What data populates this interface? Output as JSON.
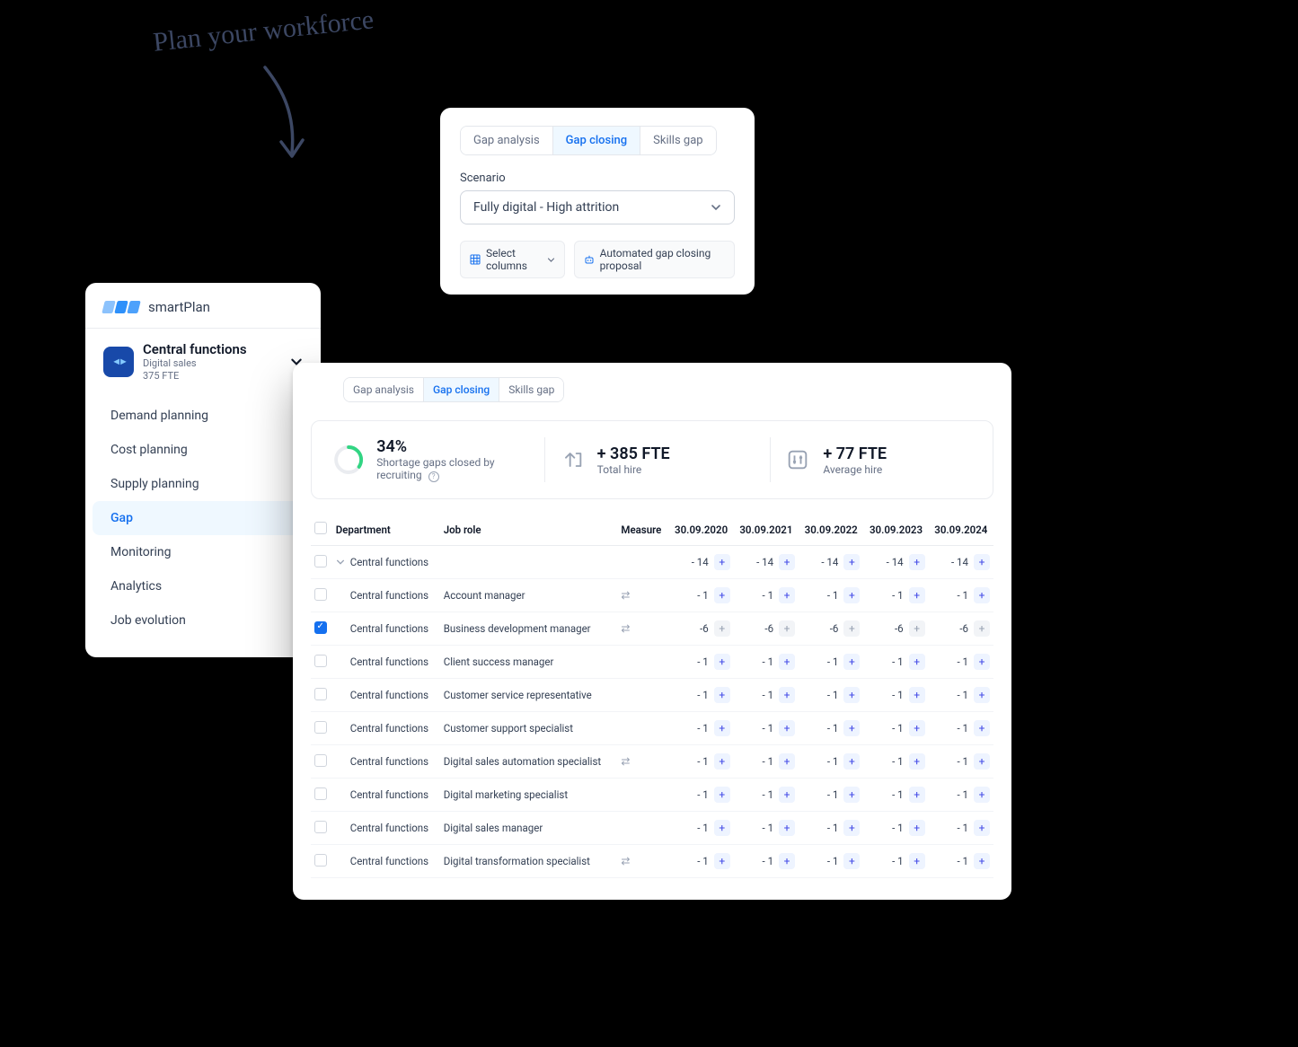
{
  "handwritten": "Plan your workforce",
  "tabs": {
    "items": [
      "Gap analysis",
      "Gap closing",
      "Skills gap"
    ],
    "active": 1
  },
  "scenario": {
    "label": "Scenario",
    "value": "Fully digital - High attrition",
    "tools": {
      "select_columns": "Select columns",
      "proposal": "Automated gap closing proposal"
    }
  },
  "brand": "smartPlan",
  "project": {
    "title": "Central functions",
    "subtitle": "Digital sales",
    "fte": "375 FTE"
  },
  "nav": {
    "items": [
      "Demand planning",
      "Cost planning",
      "Supply planning",
      "Gap",
      "Monitoring",
      "Analytics",
      "Job evolution"
    ],
    "active": 3
  },
  "stats": {
    "shortage": {
      "value": "34%",
      "label": "Shortage gaps closed by recruiting"
    },
    "total": {
      "value": "+ 385 FTE",
      "label": "Total hire"
    },
    "avg": {
      "value": "+ 77 FTE",
      "label": "Average hire"
    }
  },
  "columns": {
    "checkbox": "",
    "department": "Department",
    "role": "Job role",
    "measure": "Measure",
    "dates": [
      "30.09.2020",
      "30.09.2021",
      "30.09.2022",
      "30.09.2023",
      "30.09.2024"
    ]
  },
  "rows": [
    {
      "checked": false,
      "expandable": true,
      "department": "Central functions",
      "role": "",
      "measure": false,
      "values": [
        "- 14",
        "- 14",
        "- 14",
        "- 14",
        "- 14"
      ],
      "dim": false
    },
    {
      "checked": false,
      "expandable": false,
      "department": "Central functions",
      "role": "Account manager",
      "measure": true,
      "values": [
        "- 1",
        "- 1",
        "- 1",
        "- 1",
        "- 1"
      ],
      "dim": false
    },
    {
      "checked": true,
      "expandable": false,
      "department": "Central functions",
      "role": "Business development manager",
      "measure": true,
      "values": [
        "-6",
        "-6",
        "-6",
        "-6",
        "-6"
      ],
      "dim": true
    },
    {
      "checked": false,
      "expandable": false,
      "department": "Central functions",
      "role": "Client success manager",
      "measure": false,
      "values": [
        "- 1",
        "- 1",
        "- 1",
        "- 1",
        "- 1"
      ],
      "dim": false
    },
    {
      "checked": false,
      "expandable": false,
      "department": "Central functions",
      "role": "Customer service representative",
      "measure": false,
      "values": [
        "- 1",
        "- 1",
        "- 1",
        "- 1",
        "- 1"
      ],
      "dim": false
    },
    {
      "checked": false,
      "expandable": false,
      "department": "Central functions",
      "role": "Customer support specialist",
      "measure": false,
      "values": [
        "- 1",
        "- 1",
        "- 1",
        "- 1",
        "- 1"
      ],
      "dim": false
    },
    {
      "checked": false,
      "expandable": false,
      "department": "Central functions",
      "role": "Digital sales automation specialist",
      "measure": true,
      "values": [
        "- 1",
        "- 1",
        "- 1",
        "- 1",
        "- 1"
      ],
      "dim": false
    },
    {
      "checked": false,
      "expandable": false,
      "department": "Central functions",
      "role": "Digital marketing specialist",
      "measure": false,
      "values": [
        "- 1",
        "- 1",
        "- 1",
        "- 1",
        "- 1"
      ],
      "dim": false
    },
    {
      "checked": false,
      "expandable": false,
      "department": "Central functions",
      "role": "Digital sales manager",
      "measure": false,
      "values": [
        "- 1",
        "- 1",
        "- 1",
        "- 1",
        "- 1"
      ],
      "dim": false
    },
    {
      "checked": false,
      "expandable": false,
      "department": "Central functions",
      "role": "Digital transformation specialist",
      "measure": true,
      "values": [
        "- 1",
        "- 1",
        "- 1",
        "- 1",
        "- 1"
      ],
      "dim": false
    }
  ]
}
